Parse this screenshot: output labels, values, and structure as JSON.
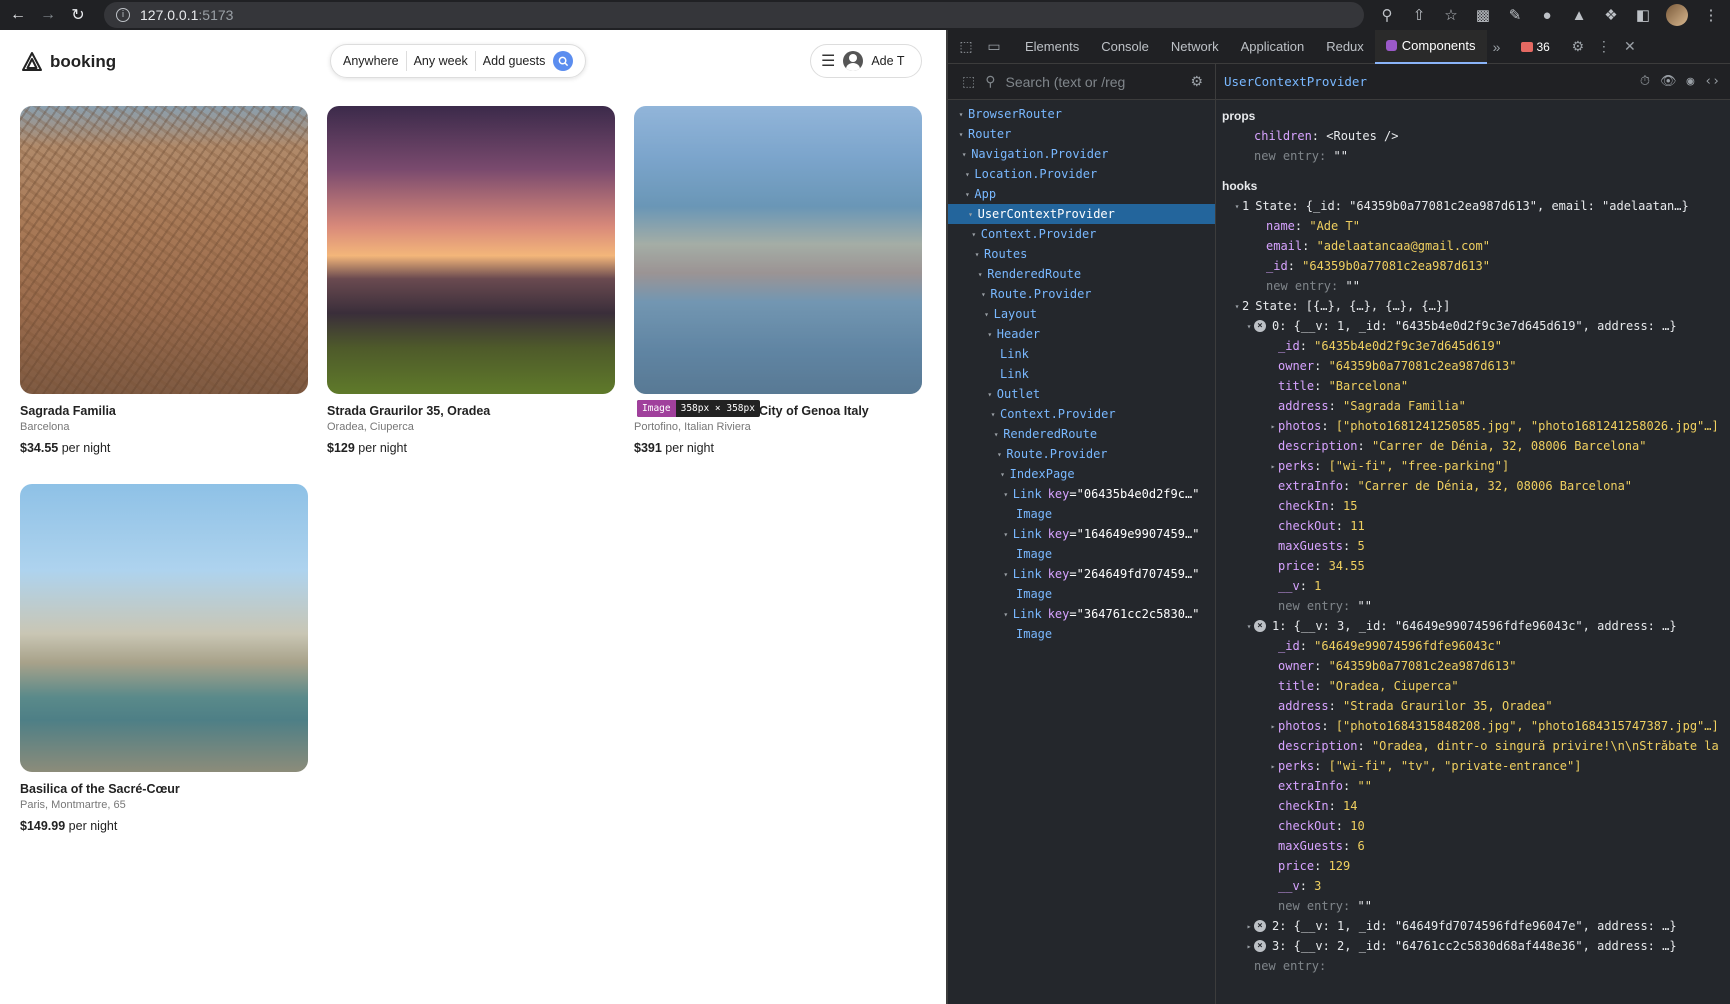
{
  "browser": {
    "url_host": "127.0.0.1",
    "url_port": ":5173"
  },
  "header": {
    "brand": "booking",
    "search": {
      "anywhere": "Anywhere",
      "any_week": "Any week",
      "add_guests": "Add guests"
    },
    "user_name": "Ade T"
  },
  "listings": [
    {
      "title": "Sagrada Familia",
      "address": "Barcelona",
      "price": "$34.55",
      "per_night": "per night"
    },
    {
      "title": "Strada Graurilor 35, Oradea",
      "address": "Oradea, Ciuperca",
      "price": "$129",
      "per_night": "per night"
    },
    {
      "title": "City of Genoa Italy",
      "address": "Portofino, Italian Riviera",
      "price": "$391",
      "per_night": "per night"
    },
    {
      "title": "Basilica of the Sacré-Cœur",
      "address": "Paris, Montmartre, 65",
      "price": "$149.99",
      "per_night": "per night"
    }
  ],
  "image_tooltip": {
    "tag": "Image",
    "size": "358px × 358px"
  },
  "devtools": {
    "tabs": [
      "Elements",
      "Console",
      "Network",
      "Application",
      "Redux",
      "Components"
    ],
    "active_tab": "Components",
    "error_count": "36",
    "search_placeholder": "Search (text or /reg",
    "selected_component": "UserContextProvider",
    "tree": [
      {
        "label": "BrowserRouter",
        "depth": 0
      },
      {
        "label": "Router",
        "depth": 0
      },
      {
        "label": "Navigation.Provider",
        "depth": 1
      },
      {
        "label": "Location.Provider",
        "depth": 2
      },
      {
        "label": "App",
        "depth": 2
      },
      {
        "label": "UserContextProvider",
        "depth": 3,
        "selected": true
      },
      {
        "label": "Context.Provider",
        "depth": 4
      },
      {
        "label": "Routes",
        "depth": 5
      },
      {
        "label": "RenderedRoute",
        "depth": 6
      },
      {
        "label": "Route.Provider",
        "depth": 7
      },
      {
        "label": "Layout",
        "depth": 8
      },
      {
        "label": "Header",
        "depth": 9
      },
      {
        "label": "Link",
        "depth": 10,
        "leaf": true
      },
      {
        "label": "Link",
        "depth": 10,
        "leaf": true
      },
      {
        "label": "Outlet",
        "depth": 9
      },
      {
        "label": "Context.Provider",
        "depth": 10
      },
      {
        "label": "RenderedRoute",
        "depth": 11
      },
      {
        "label": "Route.Provider",
        "depth": 12
      },
      {
        "label": "IndexPage",
        "depth": 13
      },
      {
        "label": "Link",
        "key": "06435b4e0d2f9c…",
        "depth": 14
      },
      {
        "label": "Image",
        "depth": 15,
        "leaf": true
      },
      {
        "label": "Link",
        "key": "164649e9907459…",
        "depth": 14
      },
      {
        "label": "Image",
        "depth": 15,
        "leaf": true
      },
      {
        "label": "Link",
        "key": "264649fd707459…",
        "depth": 14
      },
      {
        "label": "Image",
        "depth": 15,
        "leaf": true
      },
      {
        "label": "Link",
        "key": "364761cc2c5830…",
        "depth": 14
      },
      {
        "label": "Image",
        "depth": 15,
        "leaf": true
      }
    ],
    "props_title": "props",
    "hooks_title": "hooks",
    "lines": [
      {
        "t": "section",
        "text": "props"
      },
      {
        "t": "kv",
        "indent": 1,
        "k": "children",
        "v": "<Routes />",
        "vc": "w"
      },
      {
        "t": "newentry",
        "indent": 1
      },
      {
        "t": "gap"
      },
      {
        "t": "section",
        "text": "hooks"
      },
      {
        "t": "state",
        "indent": 0,
        "num": "1",
        "k": "State",
        "v": "{_id: \"64359b0a77081c2ea987d613\", email: \"adelaatan…}",
        "arrow": true
      },
      {
        "t": "kv",
        "indent": 2,
        "k": "name",
        "v": "\"Ade T\""
      },
      {
        "t": "kv",
        "indent": 2,
        "k": "email",
        "v": "\"adelaatancaa@gmail.com\""
      },
      {
        "t": "kv",
        "indent": 2,
        "k": "_id",
        "v": "\"64359b0a77081c2ea987d613\""
      },
      {
        "t": "newentry",
        "indent": 2
      },
      {
        "t": "state",
        "indent": 0,
        "num": "2",
        "k": "State",
        "v": "[{…}, {…}, {…}, {…}]",
        "arrow": true
      },
      {
        "t": "item",
        "indent": 1,
        "num": "0",
        "v": "{__v: 1, _id: \"6435b4e0d2f9c3e7d645d619\", address: …}"
      },
      {
        "t": "kv",
        "indent": 3,
        "k": "_id",
        "v": "\"6435b4e0d2f9c3e7d645d619\""
      },
      {
        "t": "kv",
        "indent": 3,
        "k": "owner",
        "v": "\"64359b0a77081c2ea987d613\""
      },
      {
        "t": "kv",
        "indent": 3,
        "k": "title",
        "v": "\"Barcelona\""
      },
      {
        "t": "kv",
        "indent": 3,
        "k": "address",
        "v": "\"Sagrada Familia\""
      },
      {
        "t": "kva",
        "indent": 3,
        "k": "photos",
        "v": "[\"photo1681241250585.jpg\", \"photo1681241258026.jpg\"…]"
      },
      {
        "t": "kv",
        "indent": 3,
        "k": "description",
        "v": "\"Carrer de Dénia, 32, 08006 Barcelona\""
      },
      {
        "t": "kva",
        "indent": 3,
        "k": "perks",
        "v": "[\"wi-fi\", \"free-parking\"]"
      },
      {
        "t": "kv",
        "indent": 3,
        "k": "extraInfo",
        "v": "\"Carrer de Dénia, 32, 08006 Barcelona\""
      },
      {
        "t": "kv",
        "indent": 3,
        "k": "checkIn",
        "v": "15"
      },
      {
        "t": "kv",
        "indent": 3,
        "k": "checkOut",
        "v": "11"
      },
      {
        "t": "kv",
        "indent": 3,
        "k": "maxGuests",
        "v": "5"
      },
      {
        "t": "kv",
        "indent": 3,
        "k": "price",
        "v": "34.55"
      },
      {
        "t": "kv",
        "indent": 3,
        "k": "__v",
        "v": "1"
      },
      {
        "t": "newentry",
        "indent": 3
      },
      {
        "t": "item",
        "indent": 1,
        "num": "1",
        "v": "{__v: 3, _id: \"64649e99074596fdfe96043c\", address: …}"
      },
      {
        "t": "kv",
        "indent": 3,
        "k": "_id",
        "v": "\"64649e99074596fdfe96043c\""
      },
      {
        "t": "kv",
        "indent": 3,
        "k": "owner",
        "v": "\"64359b0a77081c2ea987d613\""
      },
      {
        "t": "kv",
        "indent": 3,
        "k": "title",
        "v": "\"Oradea, Ciuperca\""
      },
      {
        "t": "kv",
        "indent": 3,
        "k": "address",
        "v": "\"Strada Graurilor 35, Oradea\""
      },
      {
        "t": "kva",
        "indent": 3,
        "k": "photos",
        "v": "[\"photo1684315848208.jpg\", \"photo1684315747387.jpg\"…]"
      },
      {
        "t": "kv",
        "indent": 3,
        "k": "description",
        "v": "\"Oradea, dintr-o singură privire!\\n\\nStrăbate la"
      },
      {
        "t": "kva",
        "indent": 3,
        "k": "perks",
        "v": "[\"wi-fi\", \"tv\", \"private-entrance\"]"
      },
      {
        "t": "kv",
        "indent": 3,
        "k": "extraInfo",
        "v": "\"\""
      },
      {
        "t": "kv",
        "indent": 3,
        "k": "checkIn",
        "v": "14"
      },
      {
        "t": "kv",
        "indent": 3,
        "k": "checkOut",
        "v": "10"
      },
      {
        "t": "kv",
        "indent": 3,
        "k": "maxGuests",
        "v": "6"
      },
      {
        "t": "kv",
        "indent": 3,
        "k": "price",
        "v": "129"
      },
      {
        "t": "kv",
        "indent": 3,
        "k": "__v",
        "v": "3"
      },
      {
        "t": "newentry",
        "indent": 3
      },
      {
        "t": "itemc",
        "indent": 1,
        "num": "2",
        "v": "{__v: 1, _id: \"64649fd7074596fdfe96047e\", address: …}"
      },
      {
        "t": "itemc",
        "indent": 1,
        "num": "3",
        "v": "{__v: 2, _id: \"64761cc2c5830d68af448e36\", address: …}"
      },
      {
        "t": "newentry2",
        "indent": 1
      }
    ],
    "new_entry_label": "new entry",
    "new_entry_value": "\"\""
  }
}
